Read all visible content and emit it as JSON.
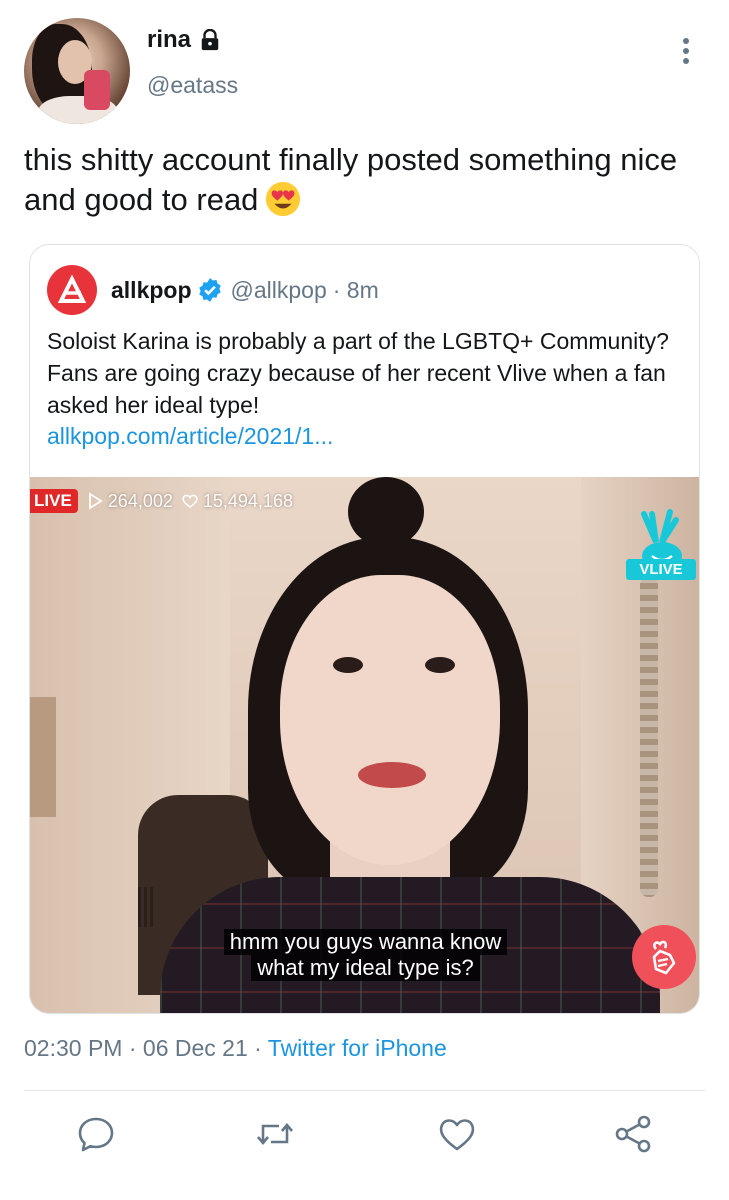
{
  "author": {
    "display_name": "rina",
    "handle": "@eatass",
    "protected_icon": "lock-icon"
  },
  "tweet": {
    "text": "this shitty account finally posted something nice and good to read",
    "emoji": "smiling-face-with-heart-eyes"
  },
  "quoted": {
    "display_name": "allkpop",
    "verified": true,
    "handle": "@allkpop",
    "time": "· 8m",
    "text": "Soloist Karina is probably a part of the LGBTQ+ Community? Fans are going crazy because of her recent Vlive when a fan asked her ideal type!",
    "link": "allkpop.com/article/2021/1...",
    "media": {
      "live_label": "LIVE",
      "views": "264,002",
      "hearts": "15,494,168",
      "brand_label": "VLIVE",
      "caption_line1": "hmm you guys wanna know",
      "caption_line2": "what my ideal type is?"
    }
  },
  "meta": {
    "time": "02:30 PM",
    "sep1": " · ",
    "date": "06 Dec 21",
    "sep2": " · ",
    "source": "Twitter for iPhone"
  },
  "actions": [
    "reply",
    "retweet",
    "like",
    "share"
  ],
  "colors": {
    "link": "#1b95e0",
    "secondary_text": "#657786",
    "verified": "#1da1f2",
    "live_red": "#e02828",
    "vlive_cyan": "#18c8d9"
  }
}
